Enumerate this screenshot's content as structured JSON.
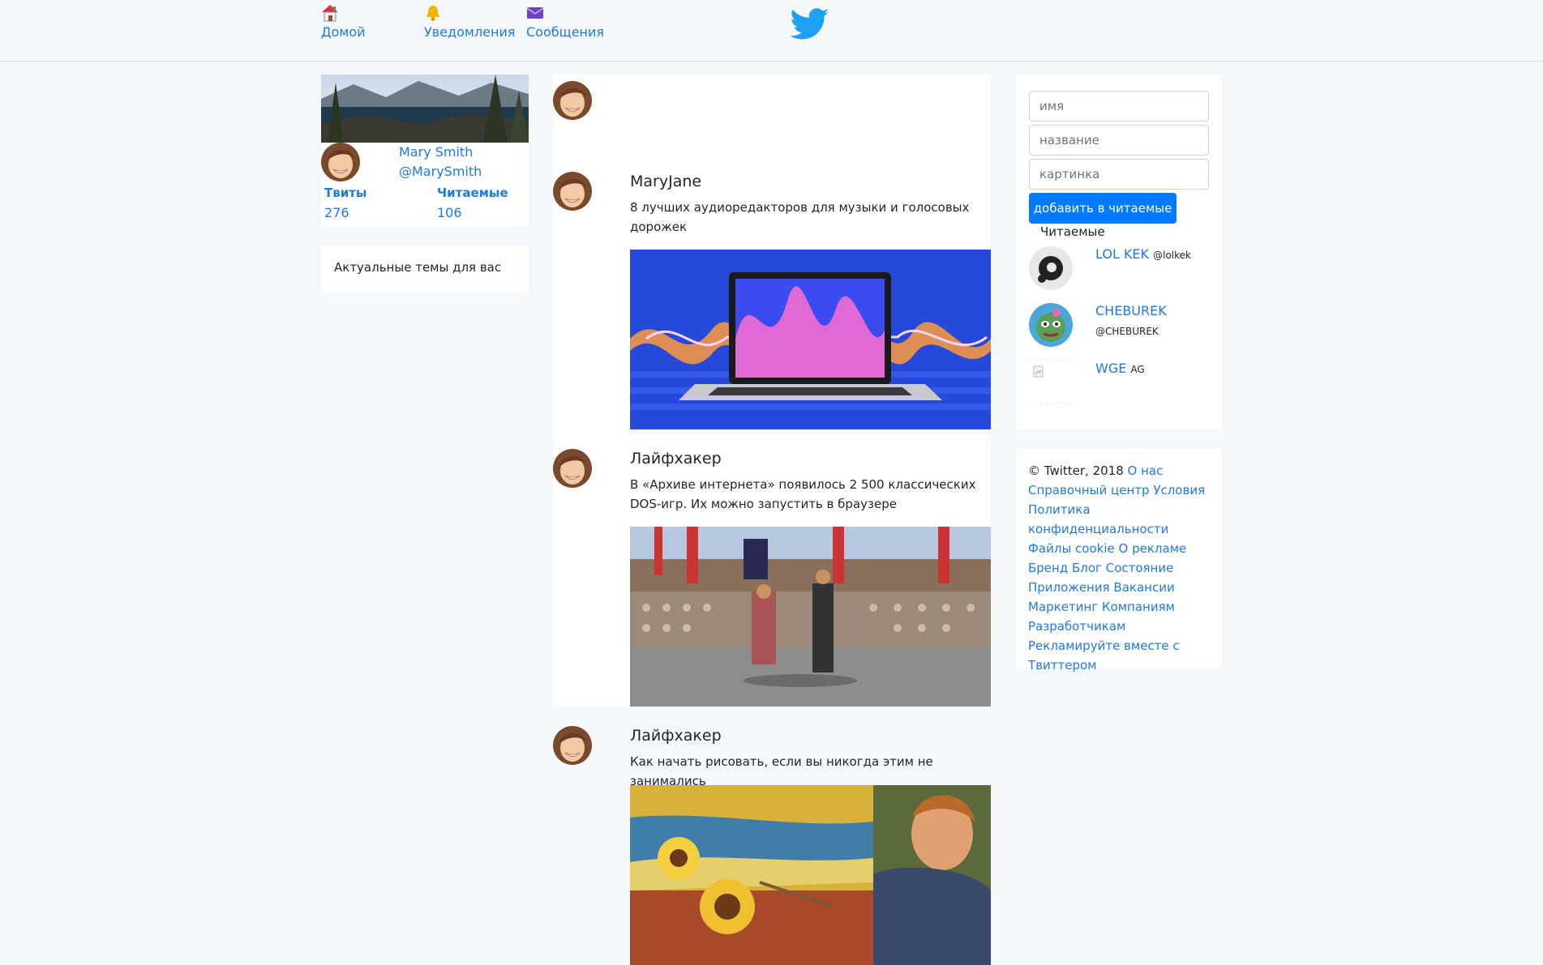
{
  "nav": {
    "home_label": "Домой",
    "notifications_label": "Уведомления",
    "messages_label": "Сообщения",
    "logo_icon": "twitter-bird-icon",
    "brand_color": "#1da1f2"
  },
  "profile": {
    "name": "Mary Smith",
    "handle": "@MarySmith",
    "tweets_label": "Твиты",
    "tweets_count": "276",
    "following_label": "Читаемые",
    "following_count": "106"
  },
  "trends": {
    "title": "Актуальные темы для вас"
  },
  "feed": {
    "tweets": [
      {
        "author": "MaryJane",
        "text": "8 лучших аудиоредакторов для музыки и голосовых дорожек"
      },
      {
        "author": "Лайфхакер",
        "text": "В «Архиве интернета» появилось 2 500 классических DOS-игр. Их можно запустить в браузере"
      },
      {
        "author": "Лайфхакер",
        "text": "Как начать рисовать, если вы никогда этим не занимались"
      }
    ]
  },
  "add_form": {
    "name_placeholder": "имя",
    "title_placeholder": "название",
    "image_placeholder": "картинка",
    "submit_label": "добавить в читаемые",
    "accent_color": "#007bff"
  },
  "following": {
    "title": "Читаемые",
    "items": [
      {
        "name": "LOL KEK",
        "handle": "@lolkek"
      },
      {
        "name": "CHEBUREK",
        "handle": "@CHEBUREK"
      },
      {
        "name": "WGE",
        "handle": "AG"
      }
    ]
  },
  "footer": {
    "copyright": "© Twitter, 2018",
    "links": [
      "О нас",
      "Справочный центр",
      "Условия",
      "Политика конфиденциальности",
      "Файлы cookie",
      "О рекламе",
      "Бренд",
      "Блог",
      "Состояние",
      "Приложения",
      "Вакансии",
      "Маркетинг",
      "Компаниям",
      "Разработчикам",
      "Рекламируйте вместе с Твиттером"
    ]
  }
}
